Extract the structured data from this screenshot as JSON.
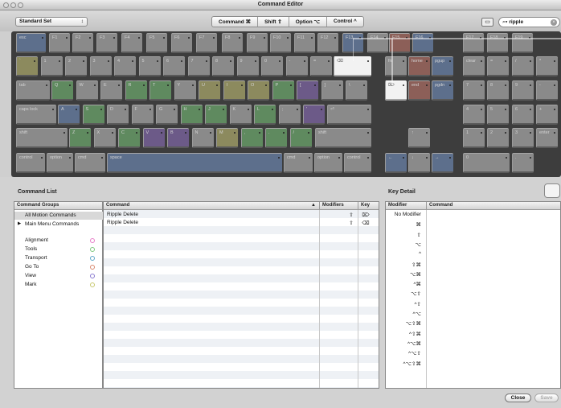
{
  "window": {
    "title": "Command Editor"
  },
  "toolbar": {
    "set_selector": "Standard Set",
    "modifiers": [
      "Command ⌘",
      "Shift ⇧",
      "Option ⌥",
      "Control ^"
    ],
    "search_value": "ripple"
  },
  "keyboard": {
    "row0": [
      "esc",
      "F1",
      "F2",
      "F3",
      "F4",
      "F5",
      "F6",
      "F7",
      "F8",
      "F9",
      "F10",
      "F11",
      "F12",
      "F13",
      "F14",
      "F15",
      "F16",
      "",
      "F17",
      "F18",
      "F19"
    ],
    "row1": [
      "`",
      "1",
      "2",
      "3",
      "4",
      "5",
      "6",
      "7",
      "8",
      "9",
      "0",
      "-",
      "=",
      "⌫"
    ],
    "row2": [
      "tab",
      "Q",
      "W",
      "E",
      "R",
      "T",
      "Y",
      "U",
      "I",
      "O",
      "P",
      "[",
      "]",
      "\\"
    ],
    "row3": [
      "caps lock",
      "A",
      "S",
      "D",
      "F",
      "G",
      "H",
      "J",
      "K",
      "L",
      ";",
      "'",
      "⏎"
    ],
    "row4": [
      "shift",
      "Z",
      "X",
      "C",
      "V",
      "B",
      "N",
      "M",
      ",",
      ".",
      "/",
      "shift"
    ],
    "row5": [
      "control",
      "option",
      "cmd",
      "space",
      "cmd",
      "option",
      "control"
    ],
    "nav": [
      "fn",
      "home",
      "pgup",
      "⌦",
      "end",
      "pgdn",
      "↑",
      "←",
      "↓",
      "→"
    ],
    "numpad": [
      "clear",
      "=",
      "/",
      "*",
      "7",
      "8",
      "9",
      "-",
      "4",
      "5",
      "6",
      "+",
      "1",
      "2",
      "3",
      "0",
      ".",
      "enter"
    ]
  },
  "command_list": {
    "title": "Command List",
    "groups_header": "Command Groups",
    "groups": [
      {
        "label": "All Motion Commands",
        "selected": true
      },
      {
        "label": "Main Menu Commands",
        "expandable": true
      }
    ],
    "categories": [
      {
        "label": "Alignment",
        "color": "#e87cc8"
      },
      {
        "label": "Tools",
        "color": "#7ec87e"
      },
      {
        "label": "Transport",
        "color": "#5fa8c8"
      },
      {
        "label": "Go To",
        "color": "#d8886e"
      },
      {
        "label": "View",
        "color": "#8a7ad0"
      },
      {
        "label": "Mark",
        "color": "#c8c86e"
      }
    ],
    "headers": {
      "command": "Command",
      "modifiers": "Modifiers",
      "key": "Key"
    },
    "rows": [
      {
        "command": "Ripple Delete",
        "modifier": "⇧",
        "key": "⌦"
      },
      {
        "command": "Ripple Delete",
        "modifier": "⇧",
        "key": "⌫"
      }
    ]
  },
  "key_detail": {
    "title": "Key Detail",
    "headers": {
      "modifier": "Modifier",
      "command": "Command"
    },
    "modifiers": [
      "No Modifier",
      "⌘",
      "⇧",
      "⌥",
      "^",
      "⇧⌘",
      "⌥⌘",
      "^⌘",
      "⌥⇧",
      "^⇧",
      "^⌥",
      "⌥⇧⌘",
      "^⇧⌘",
      "^⌥⌘",
      "^⌥⇧",
      "^⌥⇧⌘"
    ]
  },
  "buttons": {
    "close": "Close",
    "save": "Save"
  }
}
